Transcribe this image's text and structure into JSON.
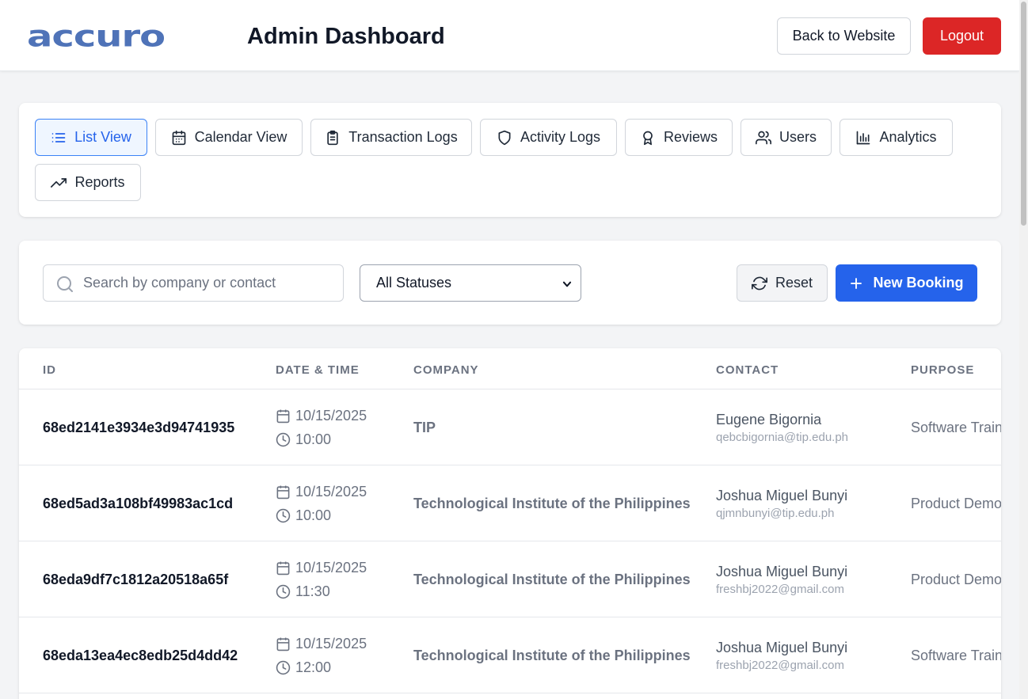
{
  "header": {
    "logo_text": "accuro",
    "title": "Admin Dashboard",
    "back_label": "Back to Website",
    "logout_label": "Logout"
  },
  "tabs": [
    {
      "label": "List View",
      "icon": "list-icon",
      "active": true
    },
    {
      "label": "Calendar View",
      "icon": "calendar-icon"
    },
    {
      "label": "Transaction Logs",
      "icon": "clipboard-icon"
    },
    {
      "label": "Activity Logs",
      "icon": "shield-icon"
    },
    {
      "label": "Reviews",
      "icon": "award-icon"
    },
    {
      "label": "Users",
      "icon": "users-icon"
    },
    {
      "label": "Analytics",
      "icon": "bar-chart-icon"
    },
    {
      "label": "Reports",
      "icon": "trending-up-icon"
    }
  ],
  "filters": {
    "search_placeholder": "Search by company or contact",
    "status_selected": "All Statuses",
    "reset_label": "Reset",
    "new_booking_label": "New Booking"
  },
  "table": {
    "columns": [
      "ID",
      "DATE & TIME",
      "COMPANY",
      "CONTACT",
      "PURPOSE"
    ],
    "rows": [
      {
        "id": "68ed2141e3934e3d94741935",
        "date": "10/15/2025",
        "time": "10:00",
        "company": "TIP",
        "contact_name": "Eugene Bigornia",
        "contact_email": "qebcbigornia@tip.edu.ph",
        "purpose": "Software Traini"
      },
      {
        "id": "68ed5ad3a108bf49983ac1cd",
        "date": "10/15/2025",
        "time": "10:00",
        "company": "Technological Institute of the Philippines",
        "contact_name": "Joshua Miguel Bunyi",
        "contact_email": "qjmnbunyi@tip.edu.ph",
        "purpose": "Product Demor"
      },
      {
        "id": "68eda9df7c1812a20518a65f",
        "date": "10/15/2025",
        "time": "11:30",
        "company": "Technological Institute of the Philippines",
        "contact_name": "Joshua Miguel Bunyi",
        "contact_email": "freshbj2022@gmail.com",
        "purpose": "Product Demor"
      },
      {
        "id": "68eda13ea4ec8edb25d4dd42",
        "date": "10/15/2025",
        "time": "12:00",
        "company": "Technological Institute of the Philippines",
        "contact_name": "Joshua Miguel Bunyi",
        "contact_email": "freshbj2022@gmail.com",
        "purpose": "Software Traini"
      }
    ]
  },
  "colors": {
    "brand": "#4f73b8",
    "primary": "#2563eb",
    "danger": "#dc2626"
  }
}
